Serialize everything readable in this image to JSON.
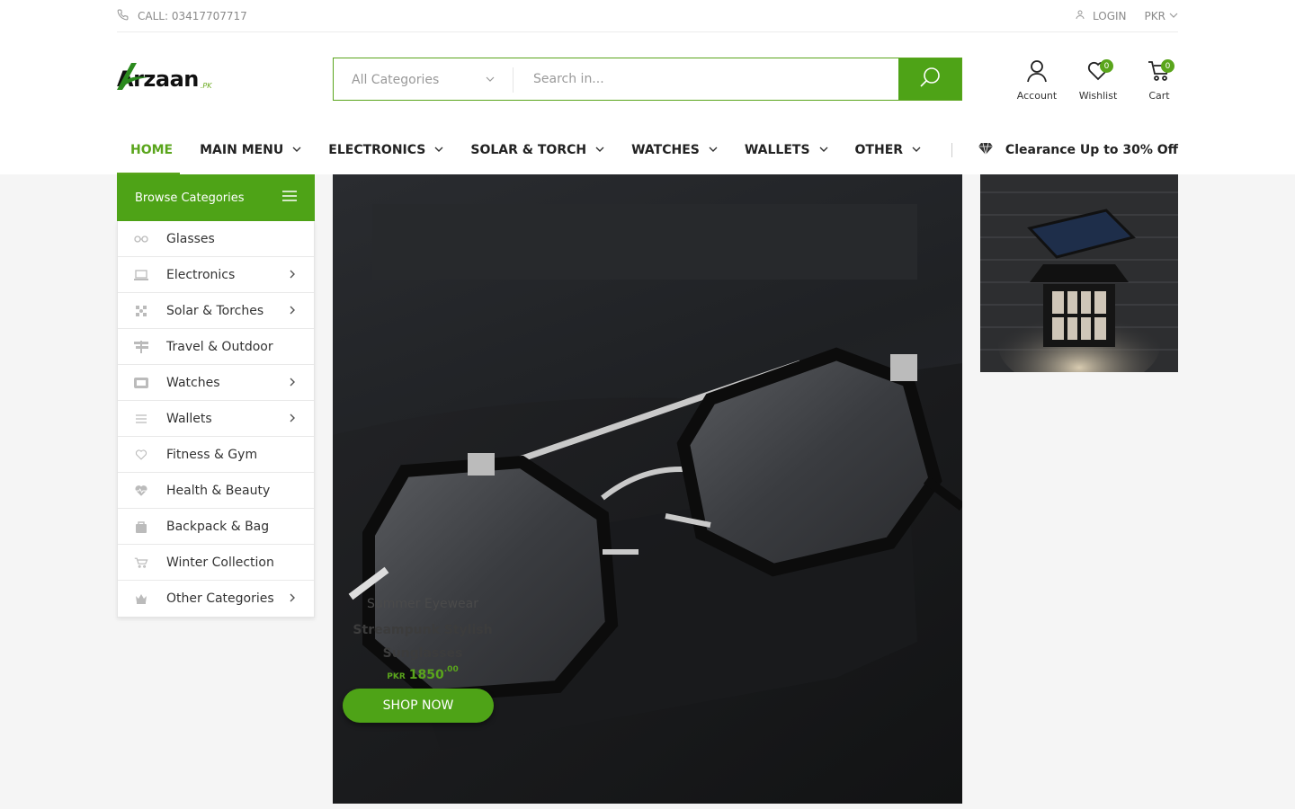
{
  "topbar": {
    "call": "CALL: 03417707717",
    "login": "LOGIN",
    "currency": "PKR"
  },
  "logo": {
    "word": "Arzaan",
    "tld": ".PK"
  },
  "search": {
    "category": "All Categories",
    "placeholder": "Search in..."
  },
  "header_icons": {
    "account": "Account",
    "wishlist": "Wishlist",
    "wishlist_count": "0",
    "cart": "Cart",
    "cart_count": "0"
  },
  "nav": {
    "items": [
      "HOME",
      "MAIN MENU",
      "ELECTRONICS",
      "SOLAR & TORCH",
      "WATCHES",
      "WALLETS",
      "OTHER"
    ],
    "promo": "Clearance Up to 30% Off"
  },
  "sidebar": {
    "title": "Browse Categories",
    "items": [
      {
        "label": "Glasses",
        "icon": "glasses-icon",
        "submenu": false
      },
      {
        "label": "Electronics",
        "icon": "laptop-icon",
        "submenu": true
      },
      {
        "label": "Solar & Torches",
        "icon": "solar-icon",
        "submenu": true
      },
      {
        "label": "Travel & Outdoor",
        "icon": "signpost-icon",
        "submenu": false
      },
      {
        "label": "Watches",
        "icon": "watch-icon",
        "submenu": true
      },
      {
        "label": "Wallets",
        "icon": "wallet-icon",
        "submenu": true
      },
      {
        "label": "Fitness & Gym",
        "icon": "heart-icon",
        "submenu": false
      },
      {
        "label": "Health & Beauty",
        "icon": "heart-pulse-icon",
        "submenu": false
      },
      {
        "label": "Backpack & Bag",
        "icon": "bag-icon",
        "submenu": false
      },
      {
        "label": "Winter Collection",
        "icon": "cart-icon",
        "submenu": false
      },
      {
        "label": "Other Categories",
        "icon": "crown-icon",
        "submenu": true
      }
    ]
  },
  "hero": {
    "subtitle": "Summer Eyewear",
    "title": "Streampunk Stylish Sunglasses",
    "price_currency": "PKR",
    "price_whole": "1850",
    "price_decimal": ".00",
    "button": "SHOP NOW"
  },
  "colors": {
    "accent": "#4ea317"
  }
}
